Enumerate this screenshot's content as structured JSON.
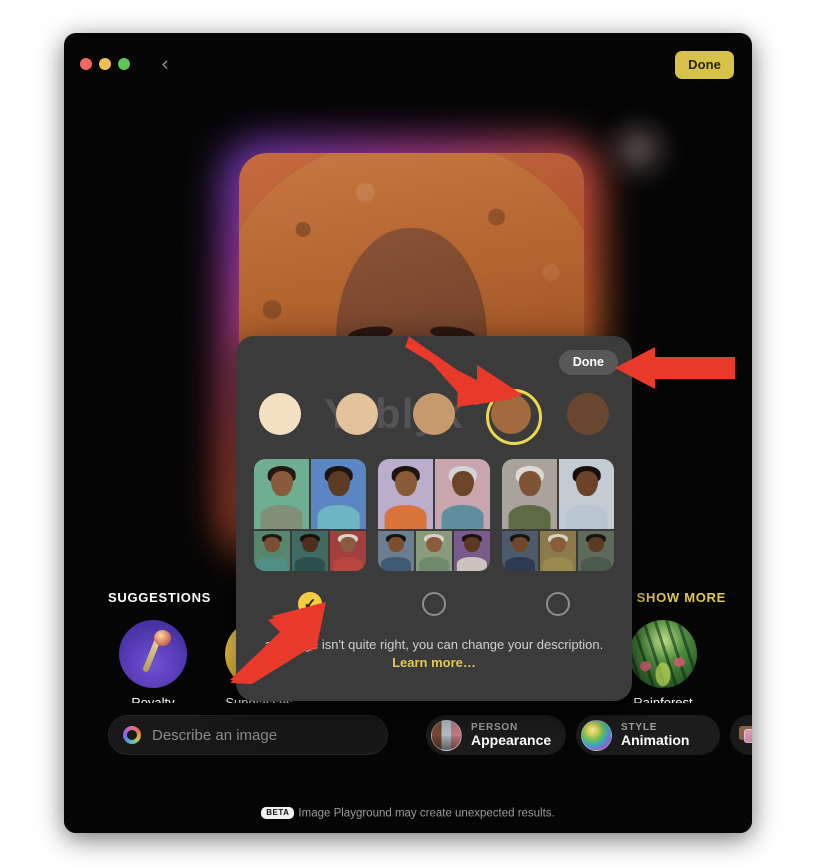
{
  "window": {
    "titlebar": {
      "traffic_lights": [
        "close",
        "minimize",
        "maximize"
      ],
      "back_icon": "‹",
      "done_label": "Done"
    }
  },
  "hero": {
    "description": "Generated cartoon portrait of a woman with curly auburn hair and red hoop earrings, framed by a purple-orange glow"
  },
  "suggestions": {
    "title": "SUGGESTIONS",
    "show_more_label": "SHOW MORE",
    "items": [
      {
        "label": "Royalty",
        "icon": "scepter-icon"
      },
      {
        "label": "Sunglasses",
        "icon": "sunglasses-icon"
      },
      {
        "label": "Rainforest",
        "icon": "rainforest-icon"
      }
    ]
  },
  "bottom_bar": {
    "describe_placeholder": "Describe an image",
    "describe_value": "",
    "describe_icon": "prompt-ring-icon",
    "chips": [
      {
        "kicker": "PERSON",
        "value": "Appearance",
        "icon": "person-thumbnail-icon"
      },
      {
        "kicker": "STYLE",
        "value": "Animation",
        "icon": "style-sphere-icon"
      }
    ],
    "photo_library_icon": "photo-library-icon",
    "footer": {
      "badge": "BETA",
      "note": "Image Playground may create unexpected results."
    }
  },
  "popover": {
    "done_label": "Done",
    "watermark": "Yablyk",
    "skin_tones": [
      {
        "name": "tone-1",
        "color": "#f2e0c0",
        "selected": false
      },
      {
        "name": "tone-2",
        "color": "#e4c39c",
        "selected": false
      },
      {
        "name": "tone-3",
        "color": "#c79a6e",
        "selected": false
      },
      {
        "name": "tone-4",
        "color": "#a26a3d",
        "selected": true
      },
      {
        "name": "tone-5",
        "color": "#6c4730",
        "selected": false
      }
    ],
    "selected_tone_ring_color": "#ecd84f",
    "appearance_options": [
      {
        "name": "appearance-option-1",
        "selected": true
      },
      {
        "name": "appearance-option-2",
        "selected": false
      },
      {
        "name": "appearance-option-3",
        "selected": false
      }
    ],
    "hint_text": "an image isn't quite right, you can change your description. ",
    "hint_link": "Learn more…"
  },
  "annotations": {
    "arrows": [
      {
        "name": "arrow-to-selected-skin-tone",
        "color": "#e8392a",
        "points_to": "skin-tone-4"
      },
      {
        "name": "arrow-to-popover-done",
        "color": "#e8392a",
        "points_to": "popover-done-button"
      },
      {
        "name": "arrow-to-selected-radio",
        "color": "#e8392a",
        "points_to": "appearance-option-1-radio"
      }
    ]
  },
  "collages": [
    {
      "top": [
        {
          "bg": "#6fae93",
          "skin": "#8a5a3c",
          "hair": "#241812",
          "cloth": "#7f8f78"
        },
        {
          "bg": "#5b86c4",
          "skin": "#5d3a24",
          "hair": "#1d1410",
          "cloth": "#6fb4c4"
        }
      ],
      "bottom": [
        {
          "bg": "#56876d",
          "skin": "#7c4e33",
          "hair": "#231711",
          "cloth": "#4f8f86"
        },
        {
          "bg": "#3f6b63",
          "skin": "#4e2f1e",
          "hair": "#16100c",
          "cloth": "#2d4f4c"
        },
        {
          "bg": "#a33f3f",
          "skin": "#8a5c3f",
          "hair": "#d8d4cc",
          "cloth": "#b8463f"
        }
      ]
    },
    {
      "top": [
        {
          "bg": "#b9aecb",
          "skin": "#8a5a36",
          "hair": "#1c1410",
          "cloth": "#d9743a"
        },
        {
          "bg": "#c9a6ad",
          "skin": "#6d4526",
          "hair": "#cfd6da",
          "cloth": "#5f8f9c"
        }
      ],
      "bottom": [
        {
          "bg": "#6c7f92",
          "skin": "#7b4f30",
          "hair": "#1a120d",
          "cloth": "#3f5a74"
        },
        {
          "bg": "#8a9b7d",
          "skin": "#8a5c3c",
          "hair": "#d6d2c8",
          "cloth": "#6d8a6a"
        },
        {
          "bg": "#7a5a8c",
          "skin": "#5c3a22",
          "hair": "#191210",
          "cloth": "#c9c4bc"
        }
      ]
    },
    {
      "top": [
        {
          "bg": "#a9a39c",
          "skin": "#7d5335",
          "hair": "#dcdad4",
          "cloth": "#5c6b44"
        },
        {
          "bg": "#c3ccd4",
          "skin": "#6b4427",
          "hair": "#16100c",
          "cloth": "#b9c6cf"
        }
      ],
      "bottom": [
        {
          "bg": "#4d5a6b",
          "skin": "#6f4627",
          "hair": "#171210",
          "cloth": "#2c3a52"
        },
        {
          "bg": "#8d7a4a",
          "skin": "#8a5c3a",
          "hair": "#d5d1c7",
          "cloth": "#9a8a4f"
        },
        {
          "bg": "#5f6b5a",
          "skin": "#5d3a22",
          "hair": "#171210",
          "cloth": "#4a5a4c"
        }
      ]
    }
  ]
}
